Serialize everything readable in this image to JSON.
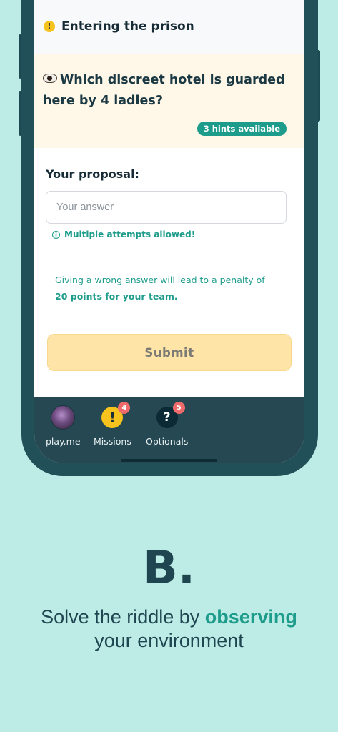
{
  "header": {
    "warning_glyph": "!",
    "title": "Entering the prison"
  },
  "question": {
    "part1": "Which ",
    "underlined": "discreet",
    "part2": " hotel is guarded here by 4 ladies?",
    "hints_badge": "3 hints available"
  },
  "proposal": {
    "label": "Your proposal:",
    "placeholder": "Your answer",
    "value": "",
    "attempts_note": "Multiple attempts allowed!",
    "penalty_prefix": "Giving a wrong answer will lead to a penalty of ",
    "penalty_points": "20",
    "penalty_suffix": " points for your team.",
    "submit_label": "Submit"
  },
  "tabs": [
    {
      "label": "play.me",
      "icon": "avatar"
    },
    {
      "label": "Missions",
      "icon": "exclamation-icon",
      "glyph": "!",
      "badge": "4"
    },
    {
      "label": "Optionals",
      "icon": "question-icon",
      "glyph": "?",
      "badge": "5"
    }
  ],
  "caption": {
    "letter": "B",
    "dot": ".",
    "line1_prefix": "Solve the riddle by ",
    "line1_accent": "observing",
    "line2": "your environment"
  },
  "colors": {
    "page_background": "#bdece6",
    "phone_frame": "#225059",
    "accent": "#1d9c8b",
    "question_background": "#fff7e8",
    "submit_background": "#ffe4a8",
    "badge_red": "#ef6b6b",
    "warning_yellow": "#f6c21d"
  }
}
